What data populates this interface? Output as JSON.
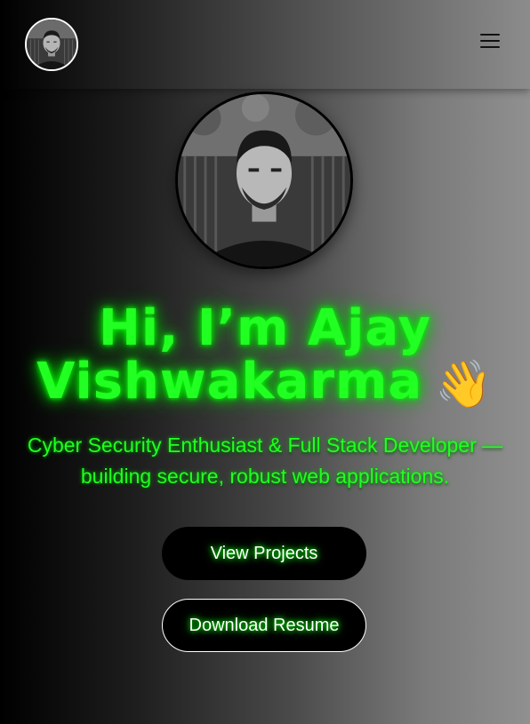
{
  "nav": {
    "avatar_icon": "profile-photo",
    "menu_icon": "hamburger-menu-icon"
  },
  "hero": {
    "avatar_icon": "profile-photo",
    "title_line1": "Hi, I’m Ajay",
    "title_line2": "Vishwakarma",
    "wave_emoji": "👋",
    "subtitle": "Cyber Security Enthusiast & Full Stack Developer — building secure, robust web applications.",
    "buttons": {
      "projects": "View Projects",
      "resume": "Download Resume"
    }
  },
  "colors": {
    "accent_green": "#22ff22",
    "button_bg": "#000000",
    "border_white": "#ffffff"
  }
}
